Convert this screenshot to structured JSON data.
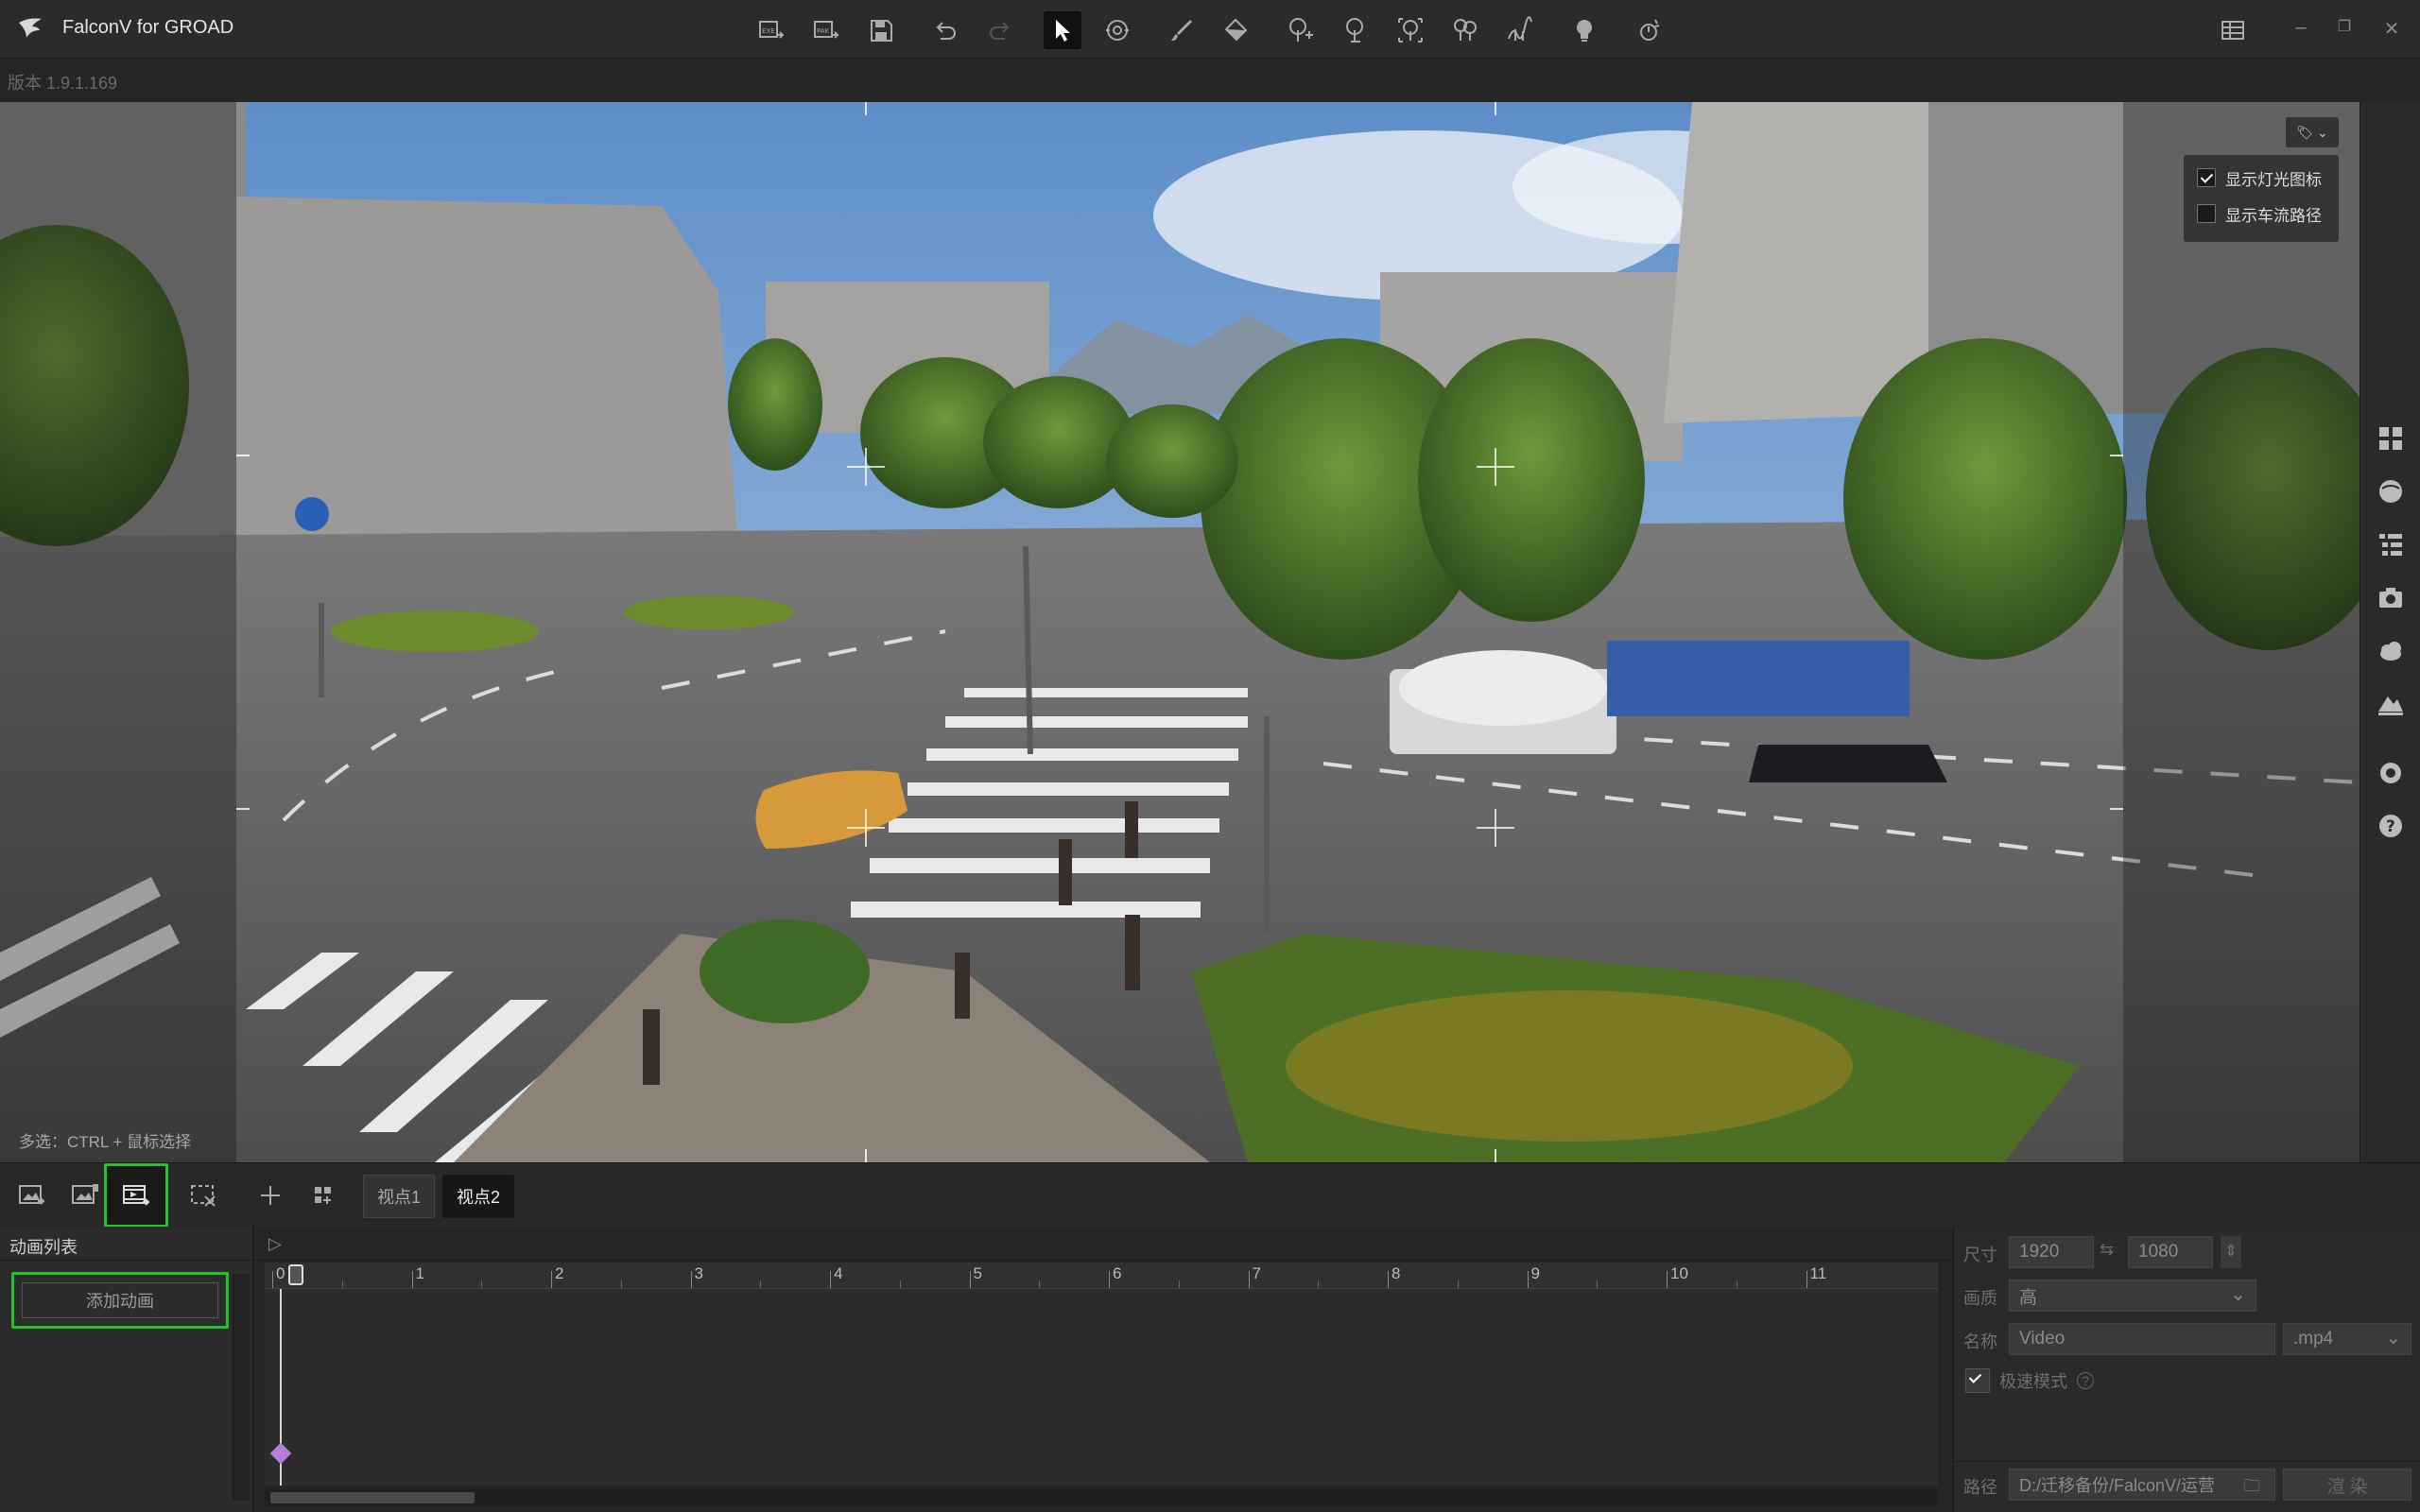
{
  "app": {
    "title": "FalconV for GROAD",
    "version": "版本 1.9.1.169"
  },
  "toolbar": {
    "icons": [
      "export-exe-icon",
      "export-pak-icon",
      "save-icon",
      "undo-icon",
      "redo-icon",
      "select-arrow-icon",
      "orbit-icon",
      "brush-icon",
      "fill-icon",
      "tree-add-icon",
      "tree-icon",
      "tree-select-icon",
      "tree-group-icon",
      "path-icon",
      "light-bulb-icon",
      "weather-icon"
    ]
  },
  "viewport": {
    "options": [
      {
        "label": "显示灯光图标",
        "checked": true
      },
      {
        "label": "显示车流路径",
        "checked": false
      }
    ],
    "hint": "多选：CTRL + 鼠标选择"
  },
  "lower_bar": {
    "tabs": [
      {
        "label": "视点1"
      },
      {
        "label": "视点2"
      }
    ]
  },
  "anim_list": {
    "header": "动画列表",
    "add_button": "添加动画"
  },
  "timeline": {
    "ticks": [
      "0",
      "1",
      "2",
      "3",
      "4",
      "5",
      "6",
      "7",
      "8",
      "9",
      "10",
      "11"
    ]
  },
  "render": {
    "size_label": "尺寸",
    "width": "1920",
    "height": "1080",
    "quality_label": "画质",
    "quality": "高",
    "name_label": "名称",
    "name_placeholder": "Video",
    "format": ".mp4",
    "fast_mode_label": "极速模式",
    "fast_mode_checked": true,
    "path_label": "路径",
    "path": "D:/迁移备份/FalconV/运营",
    "render_button": "渲 染"
  },
  "colors": {
    "highlight_green": "#22c32b",
    "keyframe": "#b57edb"
  }
}
